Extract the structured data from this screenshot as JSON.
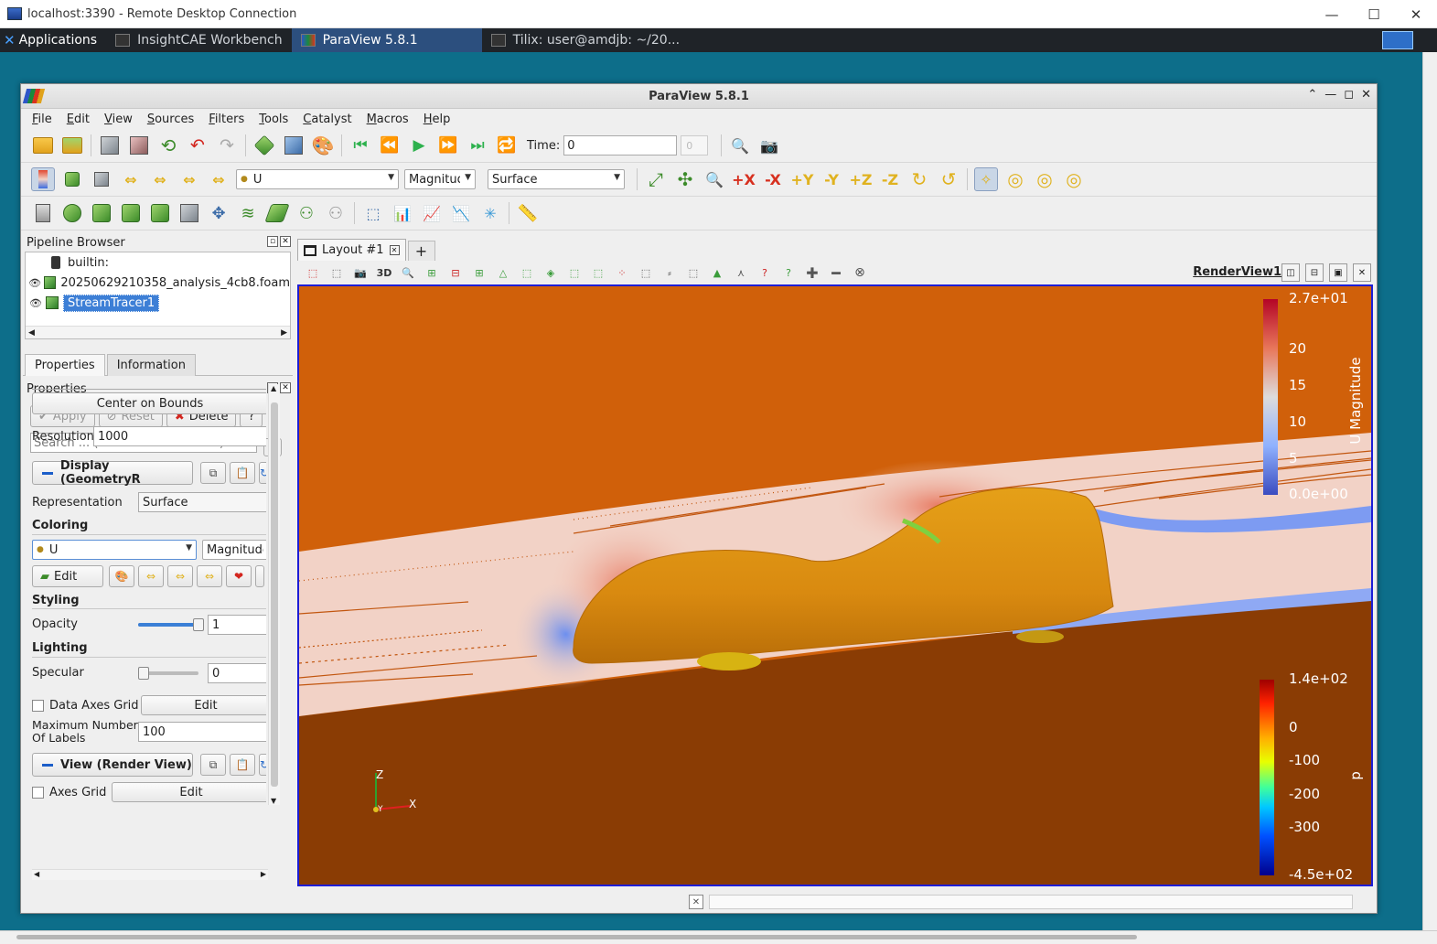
{
  "rdp": {
    "title": "localhost:3390 - Remote Desktop Connection",
    "minimize": "—",
    "maximize": "☐",
    "close": "✕"
  },
  "taskbar": {
    "apps_label": "Applications",
    "tasks": [
      {
        "label": "InsightCAE Workbench"
      },
      {
        "label": "ParaView 5.8.1"
      },
      {
        "label": "Tilix: user@amdjb: ~/20..."
      }
    ]
  },
  "window": {
    "title": "ParaView 5.8.1"
  },
  "menu": [
    "File",
    "Edit",
    "View",
    "Sources",
    "Filters",
    "Tools",
    "Catalyst",
    "Macros",
    "Help"
  ],
  "time": {
    "label": "Time:",
    "value": "0",
    "step": "0"
  },
  "toolbar2": {
    "array_combo": "U",
    "component_combo": "Magnitude",
    "representation_combo": "Surface"
  },
  "pipeline": {
    "title": "Pipeline Browser",
    "items": [
      {
        "label": "builtin:"
      },
      {
        "label": "20250629210358_analysis_4cb8.foam"
      },
      {
        "label": "StreamTracer1"
      }
    ]
  },
  "properties": {
    "tabs": [
      "Properties",
      "Information"
    ],
    "header": "Properties",
    "apply": "Apply",
    "reset": "Reset",
    "delete": "Delete",
    "help": "?",
    "search_placeholder": "Search ... (use Esc to clear text)",
    "center_on_bounds": "Center on Bounds",
    "resolution_label": "Resolution",
    "resolution_value": "1000",
    "display_section": "Display (GeometryR",
    "representation_label": "Representation",
    "representation_value": "Surface",
    "coloring_title": "Coloring",
    "coloring_array": "U",
    "coloring_component": "Magnitude",
    "edit_label": "Edit",
    "styling_title": "Styling",
    "opacity_label": "Opacity",
    "opacity_value": "1",
    "opacity_level": 1.0,
    "lighting_title": "Lighting",
    "specular_label": "Specular",
    "specular_value": "0",
    "data_axes_grid_label": "Data Axes Grid",
    "data_axes_edit": "Edit",
    "max_labels_label": "Maximum Number Of Labels",
    "max_labels_value": "100",
    "view_section": "View (Render View)",
    "axes_grid_label": "Axes Grid",
    "axes_grid_edit": "Edit"
  },
  "render": {
    "layout_tab": "Layout #1",
    "add_tab": "+",
    "view_name": "RenderView1",
    "btn_3d": "3D",
    "legend_u": {
      "title": "U Magnitude",
      "labels": [
        "2.7e+01",
        "20",
        "15",
        "10",
        "5",
        "0.0e+00"
      ]
    },
    "legend_p": {
      "title": "p",
      "labels": [
        "1.4e+02",
        "0",
        "-100",
        "-200",
        "-300",
        "-4.5e+02"
      ]
    },
    "axes": {
      "z": "Z",
      "x": "X",
      "y": "Y"
    },
    "colors": {
      "background_flow": "#d0600a",
      "floor": "#8a3c04",
      "vehicle": "#e09a12",
      "stream_pale": "#f2d2c6"
    }
  }
}
